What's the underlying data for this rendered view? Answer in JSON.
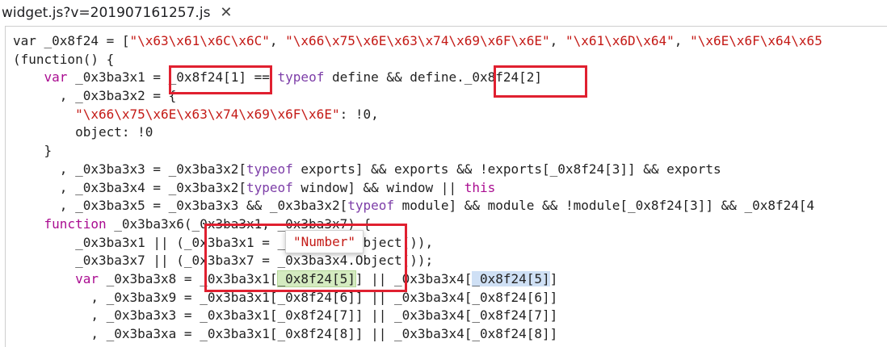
{
  "tab": {
    "filename": "widget.js?v=201907161257.js",
    "close_glyph": "✕"
  },
  "code_lines": [
    [
      [
        "plain",
        "var _0x8f24 = ["
      ],
      [
        "str",
        "\"\\x63\\x61\\x6C\\x6C\""
      ],
      [
        "plain",
        ", "
      ],
      [
        "str",
        "\"\\x66\\x75\\x6E\\x63\\x74\\x69\\x6F\\x6E\""
      ],
      [
        "plain",
        ", "
      ],
      [
        "str",
        "\"\\x61\\x6D\\x64\""
      ],
      [
        "plain",
        ", "
      ],
      [
        "str",
        "\"\\x6E\\x6F\\x64\\x65"
      ]
    ],
    [
      [
        "plain",
        "(function() {"
      ]
    ],
    [
      [
        "plain",
        "    "
      ],
      [
        "kw",
        "var"
      ],
      [
        "plain",
        " _0x3ba3x1 = _0x8f24[1] == "
      ],
      [
        "kw2",
        "typeof"
      ],
      [
        "plain",
        " define && define._0x8f24[2]"
      ]
    ],
    [
      [
        "plain",
        "      , _0x3ba3x2 = {"
      ]
    ],
    [
      [
        "plain",
        "        "
      ],
      [
        "str",
        "\"\\x66\\x75\\x6E\\x63\\x74\\x69\\x6F\\x6E\""
      ],
      [
        "plain",
        ": !0,"
      ]
    ],
    [
      [
        "plain",
        "        object: !0"
      ]
    ],
    [
      [
        "plain",
        "    }"
      ]
    ],
    [
      [
        "plain",
        "      , _0x3ba3x3 = _0x3ba3x2["
      ],
      [
        "kw2",
        "typeof"
      ],
      [
        "plain",
        " exports] && exports && !exports[_0x8f24[3]] && exports"
      ]
    ],
    [
      [
        "plain",
        "      , _0x3ba3x4 = _0x3ba3x2["
      ],
      [
        "kw2",
        "typeof"
      ],
      [
        "plain",
        " window] && window || "
      ],
      [
        "kw",
        "this"
      ]
    ],
    [
      [
        "plain",
        "      , _0x3ba3x5 = _0x3ba3x3 && _0x3ba3x2["
      ],
      [
        "kw2",
        "typeof"
      ],
      [
        "plain",
        " module] && module && !module[_0x8f24[3]] && _0x8f24[4"
      ]
    ],
    [
      [
        "plain",
        "    "
      ],
      [
        "kw",
        "function"
      ],
      [
        "plain",
        " _0x3ba3x6(_0x3ba3x1, _0x3ba3x7) {"
      ]
    ],
    [
      [
        "plain",
        "        _0x3ba3x1 || (_0x3ba3x1 = _0x3ba3x4.Object()),"
      ]
    ],
    [
      [
        "plain",
        "        _0x3ba3x7 || (_0x3ba3x7 = _0x3ba3x4.Object());"
      ]
    ],
    [
      [
        "plain",
        "        "
      ],
      [
        "kw",
        "var"
      ],
      [
        "plain",
        " _0x3ba3x8 = _0x3ba3x1["
      ],
      [
        "green",
        "_0x8f24[5]"
      ],
      [
        "plain",
        "] || _0x3ba3x4["
      ],
      [
        "blue",
        "_0x8f24[5]"
      ],
      [
        "plain",
        "]"
      ]
    ],
    [
      [
        "plain",
        "          , _0x3ba3x9 = _0x3ba3x1[_0x8f24[6]] || _0x3ba3x4[_0x8f24[6]]"
      ]
    ],
    [
      [
        "plain",
        "          , _0x3ba3x3 = _0x3ba3x1[_0x8f24[7]] || _0x3ba3x4[_0x8f24[7]]"
      ]
    ],
    [
      [
        "plain",
        "          , _0x3ba3xa = _0x3ba3x1[_0x8f24[8]] || _0x3ba3x4[_0x8f24[8]]"
      ]
    ]
  ],
  "tooltip": {
    "value": "\"Number\""
  },
  "colors": {
    "string": "#c41a16",
    "keyword": "#aa0d91",
    "annotation_box": "#e02030",
    "highlight_green": "#d4ebc0",
    "highlight_blue": "#cfe0f5"
  }
}
